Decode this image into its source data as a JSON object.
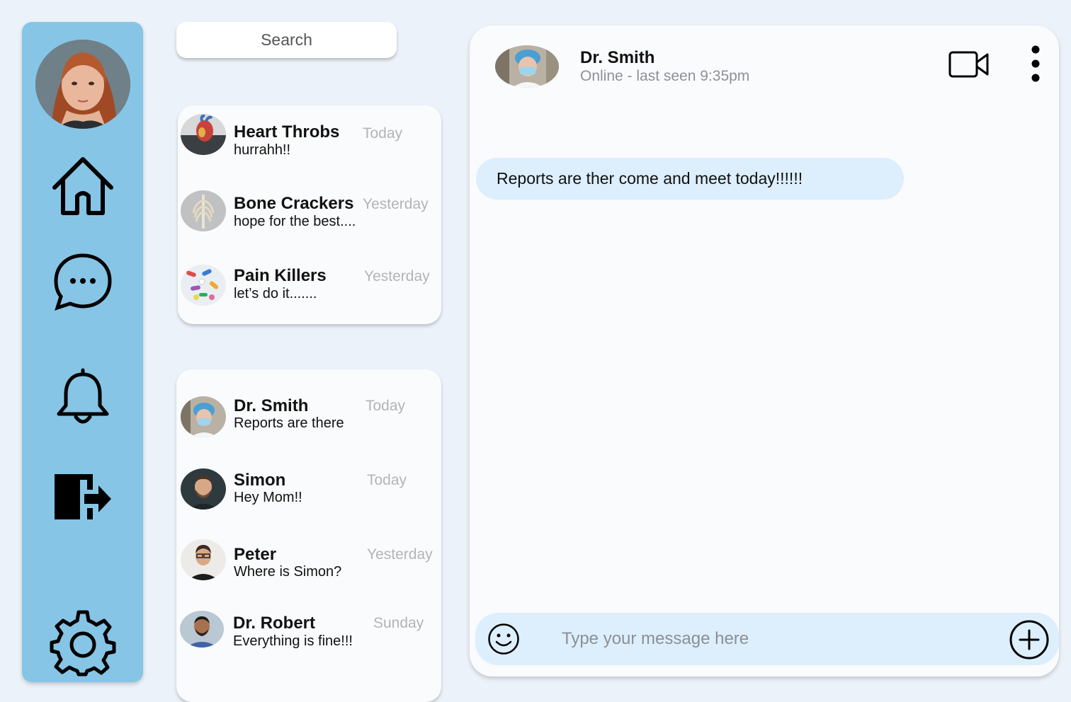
{
  "search": {
    "placeholder": "Search"
  },
  "sidebar": {
    "avatar_icon": "user-avatar",
    "items": [
      {
        "id": "home",
        "icon": "home-icon"
      },
      {
        "id": "messages",
        "icon": "chat-bubble-icon"
      },
      {
        "id": "notifications",
        "icon": "bell-icon"
      },
      {
        "id": "logout",
        "icon": "logout-icon"
      },
      {
        "id": "settings",
        "icon": "gear-icon"
      }
    ]
  },
  "groups": [
    {
      "name": "Heart Throbs",
      "message": "hurrahh!!",
      "time": "Today"
    },
    {
      "name": "Bone Crackers",
      "message": "hope for the best....",
      "time": "Yesterday"
    },
    {
      "name": "Pain Killers",
      "message": "let’s do it.......",
      "time": "Yesterday"
    }
  ],
  "contacts": [
    {
      "name": "Dr. Smith",
      "message": "Reports are there",
      "time": "Today"
    },
    {
      "name": "Simon",
      "message": "Hey Mom!!",
      "time": "Today"
    },
    {
      "name": "Peter",
      "message": "Where is Simon?",
      "time": "Yesterday"
    },
    {
      "name": "Dr. Robert",
      "message": "Everything is fine!!!",
      "time": "Sunday"
    }
  ],
  "chat": {
    "name": "Dr. Smith",
    "status": "Online - last seen 9:35pm",
    "messages": [
      {
        "text": "Reports are ther come and meet today!!!!!!"
      }
    ],
    "input_placeholder": "Type your message here"
  },
  "colors": {
    "background": "#ebf2f9",
    "sidebar": "#86c5e5",
    "bubble": "#ddeefc",
    "muted_text": "#b2b4b6"
  }
}
